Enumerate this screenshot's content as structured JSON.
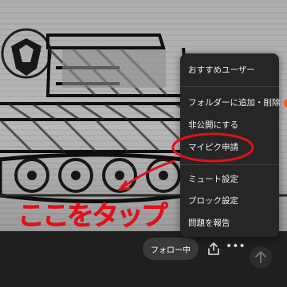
{
  "menu": {
    "items": [
      {
        "label": "おすすめユーザー"
      },
      {
        "label": "フォルダーに追加・削除",
        "badge": "!"
      },
      {
        "label": "非公開にする"
      },
      {
        "label": "マイピク申請"
      },
      {
        "label": "ミュート設定"
      },
      {
        "label": "ブロック設定"
      },
      {
        "label": "問題を報告"
      }
    ]
  },
  "actions": {
    "follow_label": "フォロー中",
    "more_label": "•••"
  },
  "annotation": {
    "text": "ここをタップ",
    "color": "#e0111b"
  },
  "icons": [
    "share-icon",
    "arrow-up-icon"
  ]
}
